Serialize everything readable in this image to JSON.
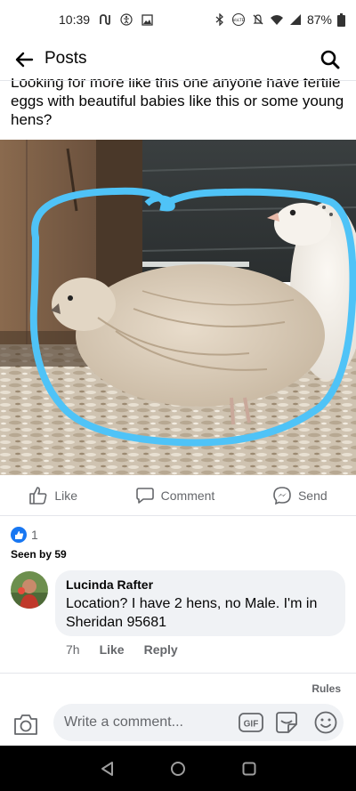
{
  "status_bar": {
    "time": "10:39",
    "battery_percent": "87%",
    "volte_label": "VoLTE"
  },
  "header": {
    "title": "Posts"
  },
  "post": {
    "text": "Looking for more like this one anyone have fertile eggs with beautiful babies like this or some young hens?",
    "photo_circle_color": "#4fc3f7"
  },
  "actions": {
    "like_label": "Like",
    "comment_label": "Comment",
    "send_label": "Send"
  },
  "reactions": {
    "count": "1",
    "seen_by": "Seen by 59"
  },
  "comment": {
    "author": "Lucinda Rafter",
    "text": "Location? I have 2 hens, no Male. I'm in Sheridan 95681",
    "time": "7h",
    "like_label": "Like",
    "reply_label": "Reply"
  },
  "rules_label": "Rules",
  "composer": {
    "placeholder": "Write a comment...",
    "gif_label": "GIF"
  },
  "colors": {
    "accent": "#1877f2",
    "secondary_text": "#65676b",
    "bubble": "#f0f2f5"
  }
}
